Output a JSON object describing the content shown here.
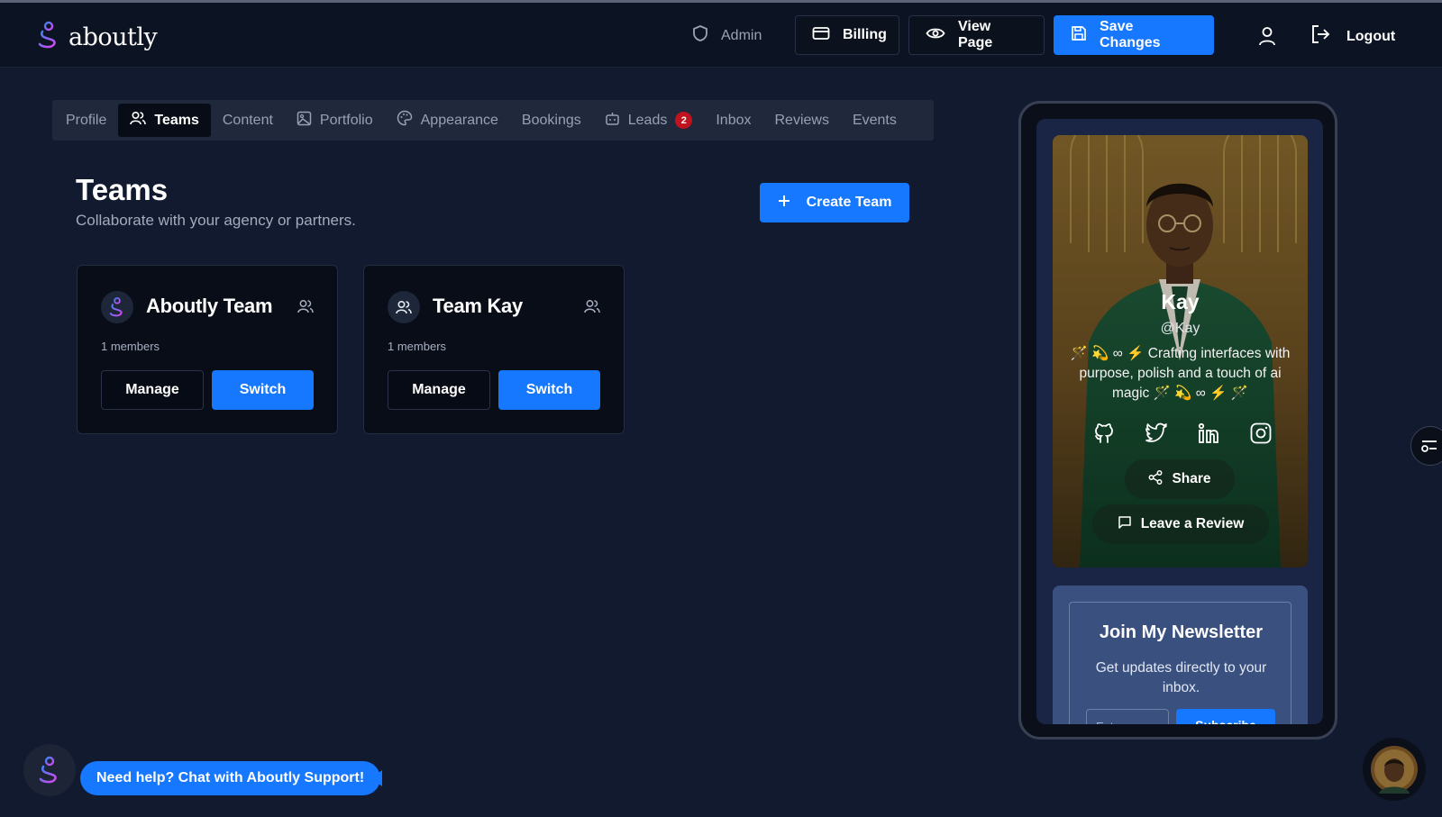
{
  "header": {
    "brand": "aboutly",
    "admin_label": "Admin",
    "billing_label": "Billing",
    "view_page_label": "View Page",
    "save_label": "Save Changes",
    "logout_label": "Logout"
  },
  "tabs": [
    {
      "label": "Profile"
    },
    {
      "label": "Teams"
    },
    {
      "label": "Content"
    },
    {
      "label": "Portfolio"
    },
    {
      "label": "Appearance"
    },
    {
      "label": "Bookings"
    },
    {
      "label": "Leads",
      "badge": "2"
    },
    {
      "label": "Inbox"
    },
    {
      "label": "Reviews"
    },
    {
      "label": "Events"
    }
  ],
  "page": {
    "title": "Teams",
    "subtitle": "Collaborate with your agency or partners.",
    "create_label": "Create Team"
  },
  "teams": [
    {
      "name": "Aboutly Team",
      "members": "1 members",
      "manage_label": "Manage",
      "switch_label": "Switch"
    },
    {
      "name": "Team Kay",
      "members": "1 members",
      "manage_label": "Manage",
      "switch_label": "Switch"
    }
  ],
  "preview": {
    "name": "Kay",
    "handle": "@Kay",
    "bio": "🪄 💫 ∞ ⚡ Crafting interfaces with purpose, polish and a touch of ai magic 🪄 💫 ∞ ⚡ 🪄",
    "share_label": "Share",
    "review_label": "Leave a Review",
    "newsletter": {
      "title": "Join My Newsletter",
      "description": "Get updates directly to your inbox.",
      "input_placeholder": "Enter",
      "submit_label": "Subscribe"
    }
  },
  "support": {
    "chat_label": "Need help? Chat with Aboutly Support!"
  },
  "colors": {
    "accent": "#1677ff",
    "background": "#111a2e",
    "header": "#0c1322",
    "badge": "#c1121f"
  }
}
